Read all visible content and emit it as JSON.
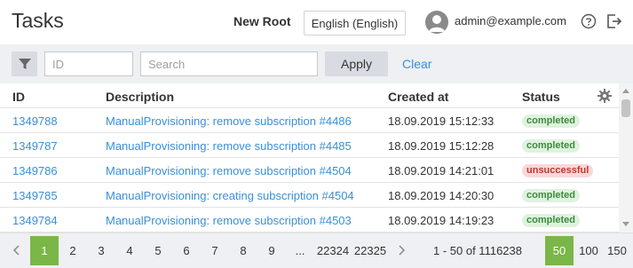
{
  "header": {
    "title": "Tasks",
    "root_label": "New Root",
    "language": "English (English)",
    "user": "admin@example.com",
    "help_icon": "help-circle-icon",
    "logout_icon": "logout-icon"
  },
  "filters": {
    "id_placeholder": "ID",
    "search_placeholder": "Search",
    "apply_label": "Apply",
    "clear_label": "Clear",
    "filter_icon": "funnel-icon"
  },
  "table": {
    "columns": [
      "ID",
      "Description",
      "Created at",
      "Status"
    ],
    "rows": [
      {
        "id": "1349788",
        "description": "ManualProvisioning: remove subscription #4486",
        "created": "18.09.2019 15:12:33",
        "status": "completed"
      },
      {
        "id": "1349787",
        "description": "ManualProvisioning: remove subscription #4485",
        "created": "18.09.2019 15:12:28",
        "status": "completed"
      },
      {
        "id": "1349786",
        "description": "ManualProvisioning: remove subscription #4504",
        "created": "18.09.2019 14:21:01",
        "status": "unsuccessful"
      },
      {
        "id": "1349785",
        "description": "ManualProvisioning: creating subscription #4504",
        "created": "18.09.2019 14:20:30",
        "status": "completed"
      },
      {
        "id": "1349784",
        "description": "ManualProvisioning: remove subscription #4503",
        "created": "18.09.2019 14:19:23",
        "status": "completed"
      }
    ]
  },
  "pagination": {
    "pages": [
      "1",
      "2",
      "3",
      "4",
      "5",
      "6",
      "7",
      "8",
      "9",
      "...",
      "22324",
      "22325"
    ],
    "current_page": "1",
    "range_text": "1 - 50 of 1116238",
    "sizes": [
      "50",
      "100",
      "150"
    ],
    "current_size": "50"
  },
  "colors": {
    "accent": "#7ab648",
    "link": "#3a8fd8",
    "completed_bg": "#dff2df",
    "unsuccessful_bg": "#f9d7da"
  }
}
